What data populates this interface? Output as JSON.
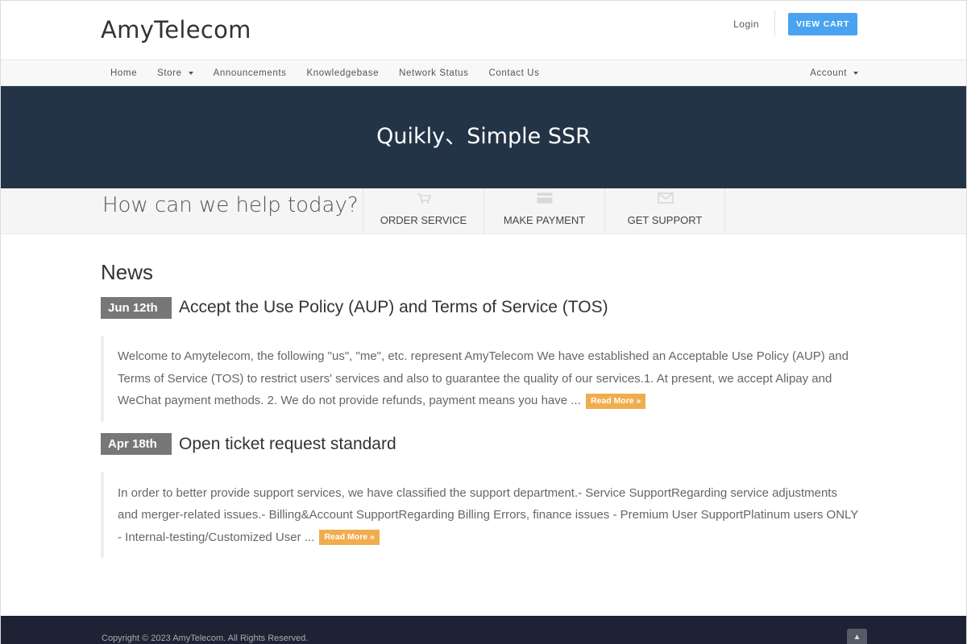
{
  "header": {
    "logo": "AmyTelecom",
    "login": "Login",
    "view_cart": "VIEW CART"
  },
  "nav": {
    "items": [
      "Home",
      "Store",
      "Announcements",
      "Knowledgebase",
      "Network Status",
      "Contact Us"
    ],
    "account": "Account"
  },
  "banner": {
    "title": "Quikly、Simple SSR"
  },
  "help": {
    "title": "How can we help today?",
    "actions": [
      {
        "label": "ORDER SERVICE",
        "icon": "cart-icon"
      },
      {
        "label": "MAKE PAYMENT",
        "icon": "credit-card-icon"
      },
      {
        "label": "GET SUPPORT",
        "icon": "envelope-icon"
      }
    ]
  },
  "news": {
    "heading": "News",
    "items": [
      {
        "date": "Jun 12th",
        "title": "Accept the Use Policy (AUP) and Terms of Service (TOS)",
        "body": "Welcome to Amytelecom, the following \"us\", \"me\", etc. represent AmyTelecom We have established an Acceptable Use Policy (AUP) and Terms of Service (TOS) to restrict users' services and also to guarantee the quality of our services.1. At present, we accept Alipay and WeChat payment methods. 2. We do not provide refunds, payment means you have ...",
        "read_more": "Read More »"
      },
      {
        "date": "Apr 18th",
        "title": "Open ticket request standard",
        "body": "In order to better provide support services, we have classified the support department.- Service SupportRegarding service adjustments and merger-related issues.- Billing&Account SupportRegarding Billing Errors, finance issues  - Premium User SupportPlatinum users ONLY - Internal-testing/Customized User ...",
        "read_more": "Read More »"
      }
    ]
  },
  "footer": {
    "copyright": "Copyright © 2023 AmyTelecom. All Rights Reserved."
  },
  "colors": {
    "banner_bg": "#243447",
    "cart_button": "#4aa3f0",
    "read_more": "#f0ad4e",
    "date_badge": "#777777",
    "footer_bg": "#1e2235"
  }
}
